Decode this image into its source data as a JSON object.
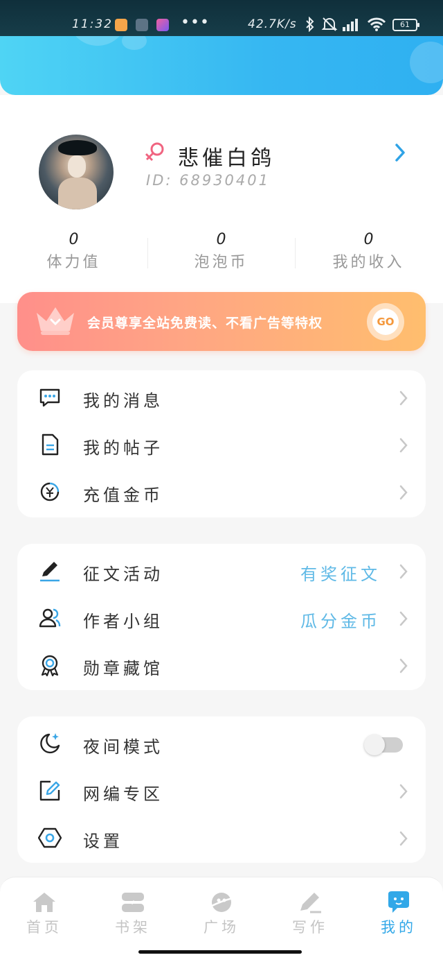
{
  "status_bar": {
    "time": "11:32",
    "dots": "•••",
    "net_speed": "42.7K/s",
    "battery": "61"
  },
  "profile": {
    "username": "悲催白鸽",
    "user_id": "ID: 68930401"
  },
  "stats": [
    {
      "value": "0",
      "label": "体力值"
    },
    {
      "value": "0",
      "label": "泡泡币"
    },
    {
      "value": "0",
      "label": "我的收入"
    }
  ],
  "vip": {
    "text": "会员尊享全站免费读、不看广告等特权",
    "go_label": "GO"
  },
  "menu_group_1": [
    {
      "label": "我的消息",
      "icon": "message-icon"
    },
    {
      "label": "我的帖子",
      "icon": "document-icon"
    },
    {
      "label": "充值金币",
      "icon": "yuan-coin-icon"
    }
  ],
  "menu_group_2": [
    {
      "label": "征文活动",
      "extra": "有奖征文",
      "icon": "pen-icon"
    },
    {
      "label": "作者小组",
      "extra": "瓜分金币",
      "icon": "users-icon"
    },
    {
      "label": "勋章藏馆",
      "icon": "medal-icon"
    }
  ],
  "menu_group_3": [
    {
      "label": "夜间模式",
      "icon": "moon-icon",
      "toggle": false
    },
    {
      "label": "网编专区",
      "icon": "edit-icon"
    },
    {
      "label": "设置",
      "icon": "settings-icon"
    }
  ],
  "bottom_nav": [
    {
      "label": "首页",
      "icon": "home-icon",
      "active": false
    },
    {
      "label": "书架",
      "icon": "bookshelf-icon",
      "active": false
    },
    {
      "label": "广场",
      "icon": "planet-icon",
      "active": false
    },
    {
      "label": "写作",
      "icon": "write-icon",
      "active": false
    },
    {
      "label": "我的",
      "icon": "profile-chat-icon",
      "active": true
    }
  ],
  "colors": {
    "accent": "#32a8e8",
    "header_start": "#4fd4f4",
    "header_end": "#2fb0f1",
    "vip_start": "#ff8f8a",
    "vip_end": "#ffbe6e",
    "tag_text": "#5fb9e6"
  }
}
